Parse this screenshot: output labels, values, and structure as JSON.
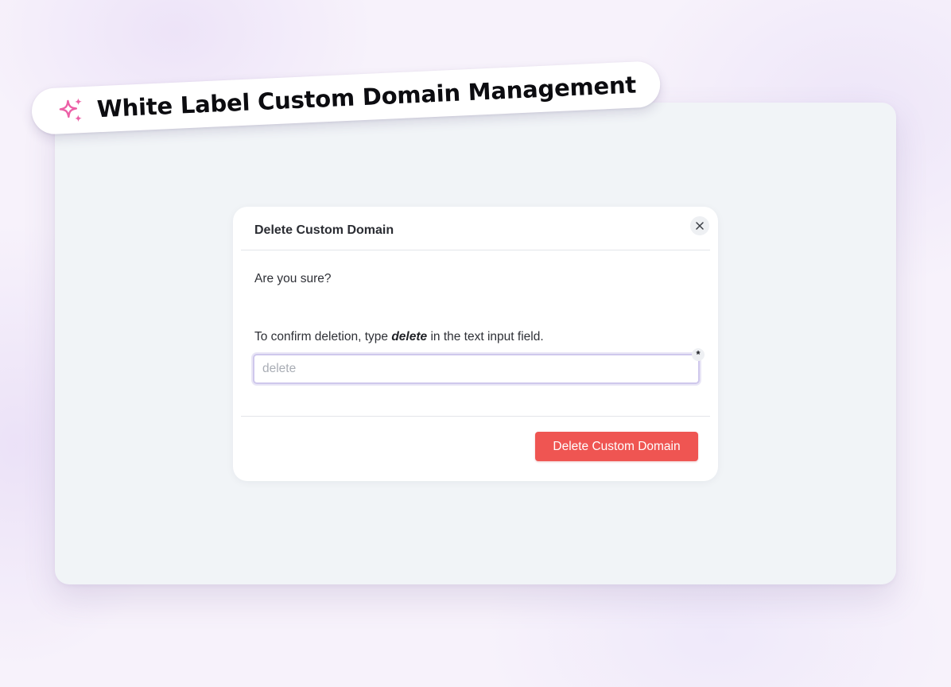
{
  "banner": {
    "title": "White Label Custom Domain Management",
    "icon": "sparkles-icon",
    "icon_color": "#ec5fa6"
  },
  "modal": {
    "title": "Delete Custom Domain",
    "close_icon": "close-icon",
    "question": "Are you sure?",
    "instruction_before": "To confirm deletion, type",
    "instruction_keyword": "delete",
    "instruction_after": "in the text input field.",
    "input": {
      "value": "",
      "placeholder": "delete",
      "required_mark": "*"
    },
    "delete_button_label": "Delete Custom Domain",
    "delete_button_color": "#ef5552"
  }
}
